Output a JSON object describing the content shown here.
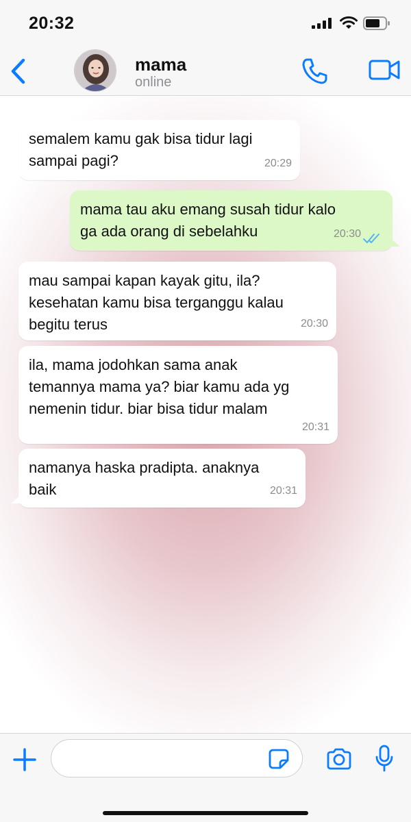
{
  "status_bar": {
    "time": "20:32"
  },
  "header": {
    "contact_name": "mama",
    "contact_status": "online"
  },
  "messages": [
    {
      "direction": "incoming",
      "text": "semalem kamu gak bisa tidur lagi\nsampai pagi?",
      "time": "20:29"
    },
    {
      "direction": "outgoing",
      "text": "mama tau aku emang susah tidur kalo\nga ada orang di sebelahku",
      "time": "20:30",
      "status": "read"
    },
    {
      "direction": "incoming",
      "text": "mau sampai kapan kayak gitu, ila?\nkesehatan kamu bisa terganggu kalau\nbegitu terus",
      "time": "20:30"
    },
    {
      "direction": "incoming",
      "text": "ila, mama jodohkan sama anak\ntemannya mama ya? biar kamu ada yg\nnemenin tidur. biar bisa tidur malam",
      "time": "20:31"
    },
    {
      "direction": "incoming",
      "text": "namanya haska pradipta. anaknya\nbaik",
      "time": "20:31"
    }
  ],
  "input_bar": {
    "message_value": "",
    "message_placeholder": ""
  },
  "colors": {
    "accent": "#0a7cff",
    "outgoing_bubble": "#dcf8c6",
    "incoming_bubble": "#ffffff",
    "read_ticks": "#4fb6ec"
  },
  "icons": [
    "back-chevron-icon",
    "avatar",
    "phone-icon",
    "video-camera-icon",
    "plus-icon",
    "sticker-icon",
    "camera-icon",
    "microphone-icon"
  ]
}
